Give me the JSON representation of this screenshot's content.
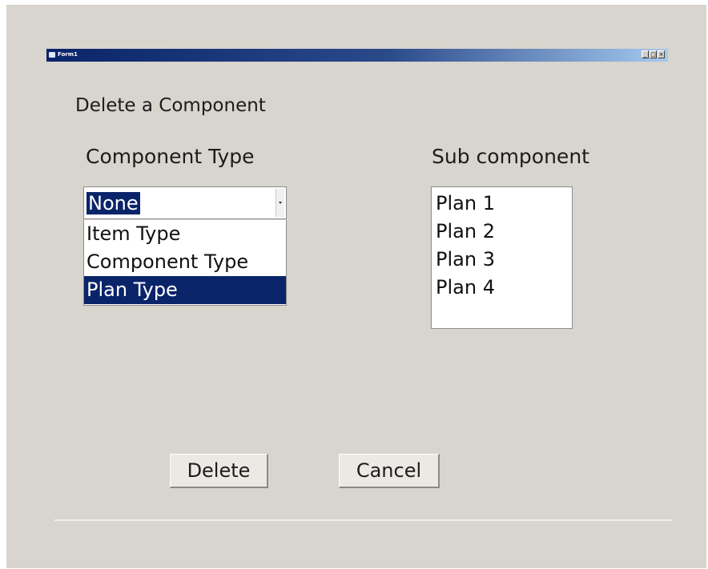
{
  "window": {
    "title": "Form1",
    "controls": [
      "_",
      "□",
      "×"
    ]
  },
  "form": {
    "heading": "Delete a Component",
    "component_type_label": "Component Type",
    "sub_component_label": "Sub component"
  },
  "component_type_combo": {
    "selected_value": "None",
    "options": [
      "Item Type",
      "Component Type",
      "Plan Type"
    ],
    "highlighted_option": "Plan Type"
  },
  "sub_component_list": {
    "items": [
      "Plan 1",
      "Plan 2",
      "Plan 3",
      "Plan 4"
    ]
  },
  "buttons": {
    "delete_label": "Delete",
    "cancel_label": "Cancel"
  },
  "colors": {
    "window_bg": "#d8d4ce",
    "selection_bg": "#0a246a",
    "titlebar_start": "#0a246a",
    "titlebar_end": "#a6caf0"
  }
}
